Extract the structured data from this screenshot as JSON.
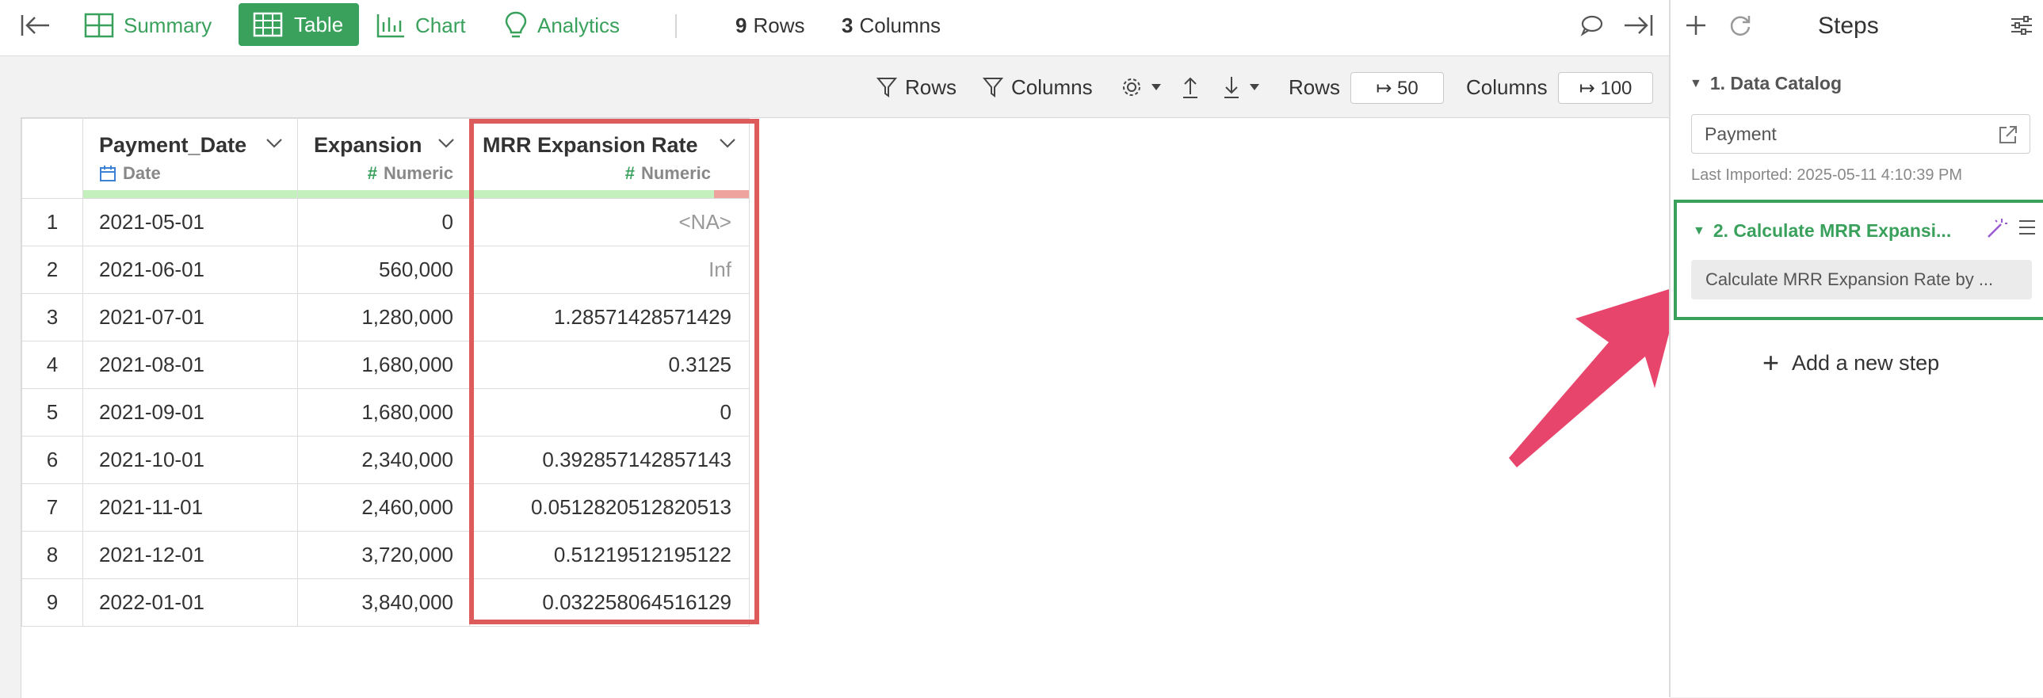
{
  "toolbar": {
    "tabs": {
      "summary": "Summary",
      "table": "Table",
      "chart": "Chart",
      "analytics": "Analytics"
    },
    "rows_count": "9",
    "rows_label": "Rows",
    "columns_count": "3",
    "columns_label": "Columns"
  },
  "subbar": {
    "rows_filter": "Rows",
    "columns_filter": "Columns",
    "rows_label": "Rows",
    "rows_value": "↦ 50",
    "columns_label": "Columns",
    "columns_value": "↦ 100"
  },
  "table": {
    "columns": [
      {
        "name": "Payment_Date",
        "type": "Date"
      },
      {
        "name": "Expansion",
        "type": "Numeric"
      },
      {
        "name": "MRR Expansion Rate",
        "type": "Numeric"
      }
    ],
    "rows": [
      {
        "n": "1",
        "date": "2021-05-01",
        "expansion": "0",
        "rate": "<NA>"
      },
      {
        "n": "2",
        "date": "2021-06-01",
        "expansion": "560,000",
        "rate": "Inf"
      },
      {
        "n": "3",
        "date": "2021-07-01",
        "expansion": "1,280,000",
        "rate": "1.28571428571429"
      },
      {
        "n": "4",
        "date": "2021-08-01",
        "expansion": "1,680,000",
        "rate": "0.3125"
      },
      {
        "n": "5",
        "date": "2021-09-01",
        "expansion": "1,680,000",
        "rate": "0"
      },
      {
        "n": "6",
        "date": "2021-10-01",
        "expansion": "2,340,000",
        "rate": "0.392857142857143"
      },
      {
        "n": "7",
        "date": "2021-11-01",
        "expansion": "2,460,000",
        "rate": "0.0512820512820513"
      },
      {
        "n": "8",
        "date": "2021-12-01",
        "expansion": "3,720,000",
        "rate": "0.51219512195122"
      },
      {
        "n": "9",
        "date": "2022-01-01",
        "expansion": "3,840,000",
        "rate": "0.032258064516129"
      }
    ]
  },
  "steps": {
    "title": "Steps",
    "step1_title": "1. Data Catalog",
    "step1_source": "Payment",
    "step1_imported": "Last Imported: 2025-05-11 4:10:39 PM",
    "step2_title": "2. Calculate MRR Expansi...",
    "step2_desc": "Calculate MRR Expansion Rate by ...",
    "add_step": "Add a new step"
  },
  "colors": {
    "accent_green": "#3aa15d",
    "highlight_red": "#de5b5b",
    "arrow_pink": "#e8456c"
  }
}
